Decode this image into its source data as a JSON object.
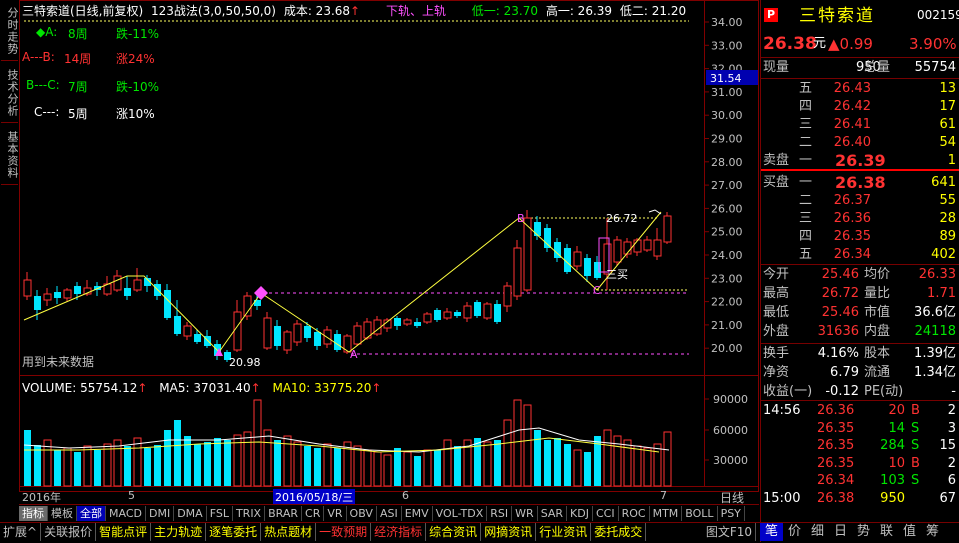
{
  "left_tabs": [
    "分时走势",
    "技术分析",
    "基本资料"
  ],
  "header": {
    "stock": "三特索道(日线,前复权)",
    "indicator": "123战法(3,0,50,50,0)",
    "cost": "成本: 23.68",
    "bands": "下轨、上轨",
    "low1": "低一: 23.70",
    "high1": "高一: 26.39",
    "low2": "低二: 21.20"
  },
  "waves": [
    {
      "marker": "◆A:",
      "weeks": "8周",
      "change": "跌-11%"
    },
    {
      "marker": "A---B:",
      "weeks": "14周",
      "change": "涨24%"
    },
    {
      "marker": "B---C:",
      "weeks": "7周",
      "change": "跌-10%"
    },
    {
      "marker": "C---:",
      "weeks": "5周",
      "change": "涨10%"
    }
  ],
  "chart_labels": {
    "future_note": "用到未来数据",
    "low_label": "20.98",
    "high_label": "26.72",
    "buy_label": "三买",
    "a": "A",
    "b": "B",
    "c": "C"
  },
  "price_axis": [
    "34.00",
    "33.00",
    "32.00",
    "31.00",
    "30.00",
    "29.00",
    "28.00",
    "27.00",
    "26.00",
    "25.00",
    "24.00",
    "23.00",
    "22.00",
    "21.00",
    "20.00"
  ],
  "price_tag": "31.54",
  "volume_header": {
    "vol": "VOLUME: 55754.12",
    "ma5": "MA5: 37031.40",
    "ma10": "MA10: 33775.20"
  },
  "vol_axis": [
    "90000",
    "60000",
    "30000"
  ],
  "date_axis": {
    "year": "2016年",
    "m5": "5",
    "cursor": "2016/05/18/三",
    "m6": "6",
    "m7": "7"
  },
  "period": "日线",
  "toolbar1": [
    "指标",
    "模板",
    "全部",
    "MACD",
    "DMI",
    "DMA",
    "FSL",
    "TRIX",
    "BRAR",
    "CR",
    "VR",
    "OBV",
    "ASI",
    "EMV",
    "VOL-TDX",
    "RSI",
    "WR",
    "SAR",
    "KDJ",
    "CCI",
    "ROC",
    "MTM",
    "BOLL",
    "PSY"
  ],
  "toolbar2": [
    "扩展^",
    "关联报价",
    "智能点评",
    "主力轨迹",
    "逐笔委托",
    "热点题材",
    "一致预期",
    "经济指标",
    "综合资讯",
    "网摘资讯",
    "行业资讯",
    "委托成交"
  ],
  "toolbar2_right": "图文F10",
  "quote": {
    "badge": "P",
    "name": "三特索道",
    "code": "002159",
    "price": "26.38",
    "unit": "元",
    "change": "▲0.99",
    "pct": "3.90%",
    "now_lbl": "现量",
    "now_val": "950",
    "total_lbl": "总量",
    "total_val": "55754",
    "asks": [
      {
        "lbl": "五",
        "price": "26.43",
        "vol": "13"
      },
      {
        "lbl": "四",
        "price": "26.42",
        "vol": "17"
      },
      {
        "lbl": "三",
        "price": "26.41",
        "vol": "61"
      },
      {
        "lbl": "二",
        "price": "26.40",
        "vol": "54"
      },
      {
        "lbl": "一",
        "price": "26.39",
        "vol": "1"
      }
    ],
    "ask_lbl": "卖盘",
    "bid_lbl": "买盘",
    "bids": [
      {
        "lbl": "一",
        "price": "26.38",
        "vol": "641"
      },
      {
        "lbl": "二",
        "price": "26.37",
        "vol": "55"
      },
      {
        "lbl": "三",
        "price": "26.36",
        "vol": "28"
      },
      {
        "lbl": "四",
        "price": "26.35",
        "vol": "89"
      },
      {
        "lbl": "五",
        "price": "26.34",
        "vol": "402"
      }
    ],
    "stats": [
      {
        "l1": "今开",
        "v1": "25.46",
        "l2": "均价",
        "v2": "26.33"
      },
      {
        "l1": "最高",
        "v1": "26.72",
        "l2": "量比",
        "v2": "1.71"
      },
      {
        "l1": "最低",
        "v1": "25.46",
        "l2": "市值",
        "v2": "36.6亿"
      },
      {
        "l1": "外盘",
        "v1": "31636",
        "l2": "内盘",
        "v2": "24118"
      }
    ],
    "fin": [
      {
        "l1": "换手",
        "v1": "4.16%",
        "l2": "股本",
        "v2": "1.39亿"
      },
      {
        "l1": "净资",
        "v1": "6.79",
        "l2": "流通",
        "v2": "1.34亿"
      },
      {
        "l1": "收益(一)",
        "v1": "-0.12",
        "l2": "PE(动)",
        "v2": "-"
      }
    ],
    "ticks": [
      {
        "time": "14:56",
        "price": "26.36",
        "vol": "20",
        "side": "B",
        "n": "2"
      },
      {
        "time": "",
        "price": "26.35",
        "vol": "14",
        "side": "S",
        "n": "3"
      },
      {
        "time": "",
        "price": "26.35",
        "vol": "284",
        "side": "S",
        "n": "15"
      },
      {
        "time": "",
        "price": "26.35",
        "vol": "10",
        "side": "B",
        "n": "2"
      },
      {
        "time": "",
        "price": "26.34",
        "vol": "103",
        "side": "S",
        "n": "6"
      },
      {
        "time": "15:00",
        "price": "26.38",
        "vol": "950",
        "side": "",
        "n": "67"
      }
    ],
    "bottom_tabs": [
      "笔",
      "价",
      "细",
      "日",
      "势",
      "联",
      "值",
      "筹"
    ]
  }
}
